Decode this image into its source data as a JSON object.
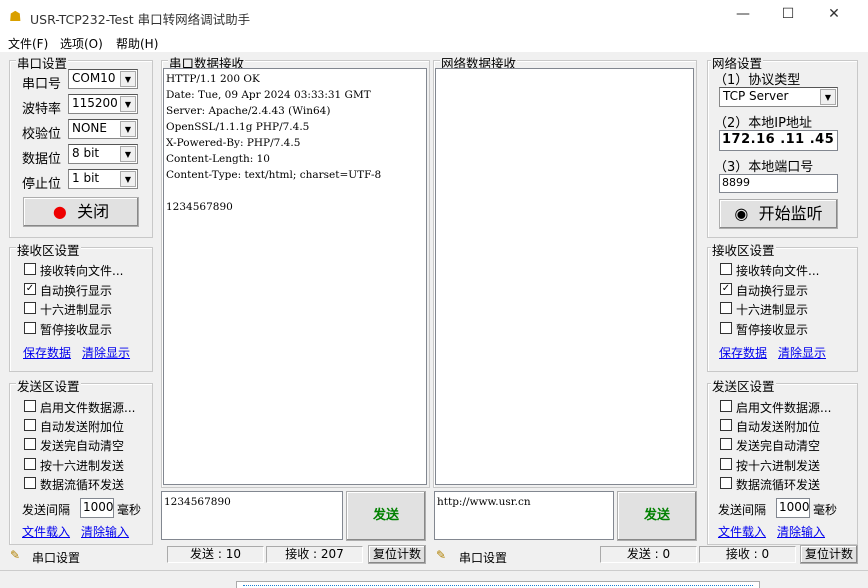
{
  "window": {
    "title": "USR-TCP232-Test 串口转网络调试助手",
    "min": "—",
    "max": "☐",
    "close": "✕"
  },
  "menu": [
    "文件(F)",
    "选项(O)",
    "帮助(H)"
  ],
  "serial": {
    "group": "串口设置",
    "port_label": "串口号",
    "port": "COM10",
    "baud_label": "波特率",
    "baud": "115200",
    "parity_label": "校验位",
    "parity": "NONE",
    "data_label": "数据位",
    "data": "8 bit",
    "stop_label": "停止位",
    "stop": "1 bit",
    "close_btn": "关闭"
  },
  "recv_left": {
    "group": "接收区设置",
    "opts": [
      {
        "label": "接收转向文件...",
        "checked": false
      },
      {
        "label": "自动换行显示",
        "checked": true
      },
      {
        "label": "十六进制显示",
        "checked": false
      },
      {
        "label": "暂停接收显示",
        "checked": false
      }
    ],
    "save": "保存数据",
    "clear": "清除显示"
  },
  "send_left": {
    "group": "发送区设置",
    "opts": [
      {
        "label": "启用文件数据源...",
        "checked": false
      },
      {
        "label": "自动发送附加位",
        "checked": false
      },
      {
        "label": "发送完自动清空",
        "checked": false
      },
      {
        "label": "按十六进制发送",
        "checked": false
      },
      {
        "label": "数据流循环发送",
        "checked": false
      }
    ],
    "interval_label": "发送间隔",
    "interval": "1000",
    "unit": "毫秒",
    "load": "文件载入",
    "clear": "清除输入"
  },
  "serial_recv": {
    "group": "串口数据接收",
    "content": "HTTP/1.1 200 OK\nDate: Tue, 09 Apr 2024 03:33:31 GMT\nServer: Apache/2.4.43 (Win64)\nOpenSSL/1.1.1g PHP/7.4.5\nX-Powered-By: PHP/7.4.5\nContent-Length: 10\nContent-Type: text/html; charset=UTF-8\n\n1234567890"
  },
  "net_recv": {
    "group": "网络数据接收",
    "content": ""
  },
  "serial_send": {
    "input": "1234567890",
    "button": "发送"
  },
  "net_send": {
    "input": "http://www.usr.cn",
    "button": "发送"
  },
  "net": {
    "group": "网络设置",
    "proto_label": "（1）协议类型",
    "proto": "TCP Server",
    "ip_label": "（2）本地IP地址",
    "ip": "172.16 .11 .45",
    "port_label": "（3）本地端口号",
    "port": "8899",
    "listen_btn": "开始监听"
  },
  "recv_right": {
    "group": "接收区设置",
    "opts": [
      {
        "label": "接收转向文件...",
        "checked": false
      },
      {
        "label": "自动换行显示",
        "checked": true
      },
      {
        "label": "十六进制显示",
        "checked": false
      },
      {
        "label": "暂停接收显示",
        "checked": false
      }
    ],
    "save": "保存数据",
    "clear": "清除显示"
  },
  "send_right": {
    "group": "发送区设置",
    "opts": [
      {
        "label": "启用文件数据源...",
        "checked": false
      },
      {
        "label": "自动发送附加位",
        "checked": false
      },
      {
        "label": "发送完自动清空",
        "checked": false
      },
      {
        "label": "按十六进制发送",
        "checked": false
      },
      {
        "label": "数据流循环发送",
        "checked": false
      }
    ],
    "interval_label": "发送间隔",
    "interval": "1000",
    "unit": "毫秒",
    "load": "文件载入",
    "clear": "清除输入"
  },
  "status_left": {
    "label": "串口设置",
    "sent": "发送 : 10",
    "recv": "接收 : 207",
    "reset": "复位计数"
  },
  "status_right": {
    "label": "串口设置",
    "sent": "发送 : 0",
    "recv": "接收 : 0",
    "reset": "复位计数"
  }
}
